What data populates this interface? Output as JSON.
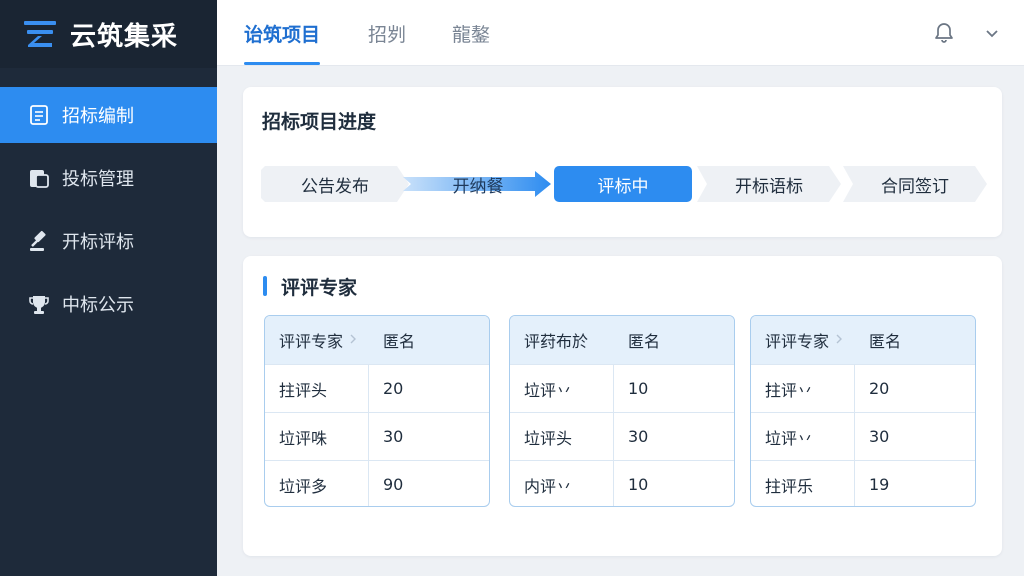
{
  "brand": {
    "name": "云筑集采"
  },
  "sidebar": {
    "items": [
      {
        "label": "招标编制",
        "icon": "document-icon",
        "active": true
      },
      {
        "label": "投标管理",
        "icon": "folder-icon",
        "active": false
      },
      {
        "label": "开标评标",
        "icon": "gavel-icon",
        "active": false
      },
      {
        "label": "中标公示",
        "icon": "trophy-icon",
        "active": false
      }
    ]
  },
  "topbar": {
    "tabs": [
      {
        "label": "诒筑项目",
        "active": true
      },
      {
        "label": "招刿",
        "active": false
      },
      {
        "label": "龍鏊",
        "active": false
      }
    ],
    "icons": [
      "bell-icon",
      "chevron-down-icon"
    ]
  },
  "progress": {
    "title": "招标项目进度",
    "steps": [
      {
        "label": "公告发布",
        "state": "done"
      },
      {
        "label": "开纳餐",
        "state": "done"
      },
      {
        "label": "评标中",
        "state": "current"
      },
      {
        "label": "开标语标",
        "state": "pending"
      },
      {
        "label": "合同签订",
        "state": "pending"
      }
    ]
  },
  "experts": {
    "title": "评评专家",
    "tables": [
      {
        "headers": [
          "评评专家",
          "匿名"
        ],
        "rows": [
          [
            "拄评头",
            "20"
          ],
          [
            "垃评咮",
            "30"
          ],
          [
            "垃评多",
            "90"
          ]
        ]
      },
      {
        "headers": [
          "评荮布於",
          "匿名"
        ],
        "rows": [
          [
            "垃评丷",
            "10"
          ],
          [
            "垃评头",
            "30"
          ],
          [
            "内评丷",
            "10"
          ]
        ]
      },
      {
        "headers": [
          "评评专家",
          "匿名"
        ],
        "rows": [
          [
            "拄评丷",
            "20"
          ],
          [
            "垃评丷",
            "30"
          ],
          [
            "拄评乐",
            "19"
          ]
        ]
      }
    ]
  },
  "colors": {
    "accent": "#2d8cf0",
    "sidebar": "#1e2a3a",
    "table_border": "#a9cdee",
    "table_header": "#e4f0fb"
  }
}
